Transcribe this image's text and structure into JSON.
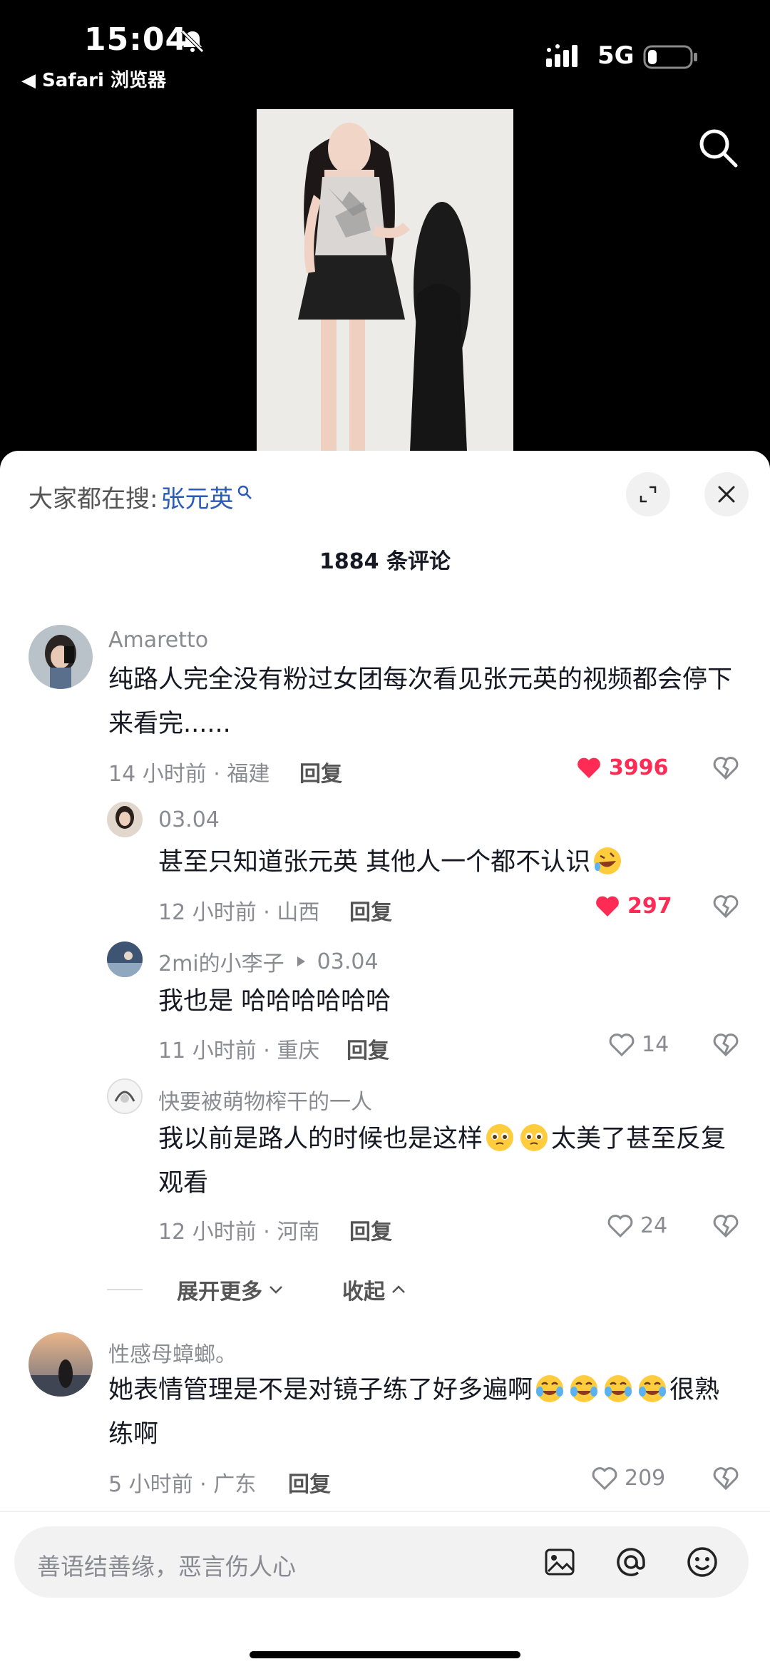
{
  "status_bar": {
    "time": "15:04",
    "back_app": "◀ Safari 浏览器",
    "network": "5G"
  },
  "search_bar": {
    "label": "大家都在搜:",
    "keyword": "张元英"
  },
  "comment_count": "1884 条评论",
  "comments": [
    {
      "user": "Amaretto",
      "text": "纯路人完全没有粉过女团每次看见张元英的视频都会停下来看完......",
      "meta": "14 小时前 · 福建",
      "reply": "回复",
      "likes": "3996",
      "liked": true
    },
    {
      "user": "03.04",
      "text": "甚至只知道张元英 其他人一个都不认识",
      "meta": "12 小时前 · 山西",
      "reply": "回复",
      "likes": "297",
      "liked": true
    },
    {
      "user": "2mi的小李子",
      "reply_to": "03.04",
      "text": "我也是 哈哈哈哈哈哈",
      "meta": "11 小时前 · 重庆",
      "reply": "回复",
      "likes": "14",
      "liked": false
    },
    {
      "user": "快要被萌物榨干的一人",
      "text_a": "我以前是路人的时候也是这样",
      "text_b": "太美了甚至反复观看",
      "meta": "12 小时前 · 河南",
      "reply": "回复",
      "likes": "24",
      "liked": false
    },
    {
      "user": "性感母蟑螂。",
      "text_a": "她表情管理是不是对镜子练了好多遍啊",
      "text_b": "很熟练啊",
      "meta": "5 小时前 · 广东",
      "reply": "回复",
      "likes": "209",
      "liked": false
    }
  ],
  "expand_more": "展开更多",
  "collapse": "收起",
  "input": {
    "placeholder": "善语结善缘，恶言伤人心"
  },
  "colors": {
    "liked": "#fe2c55",
    "keyword": "#2b5bb8",
    "muted": "#8a8b91"
  }
}
